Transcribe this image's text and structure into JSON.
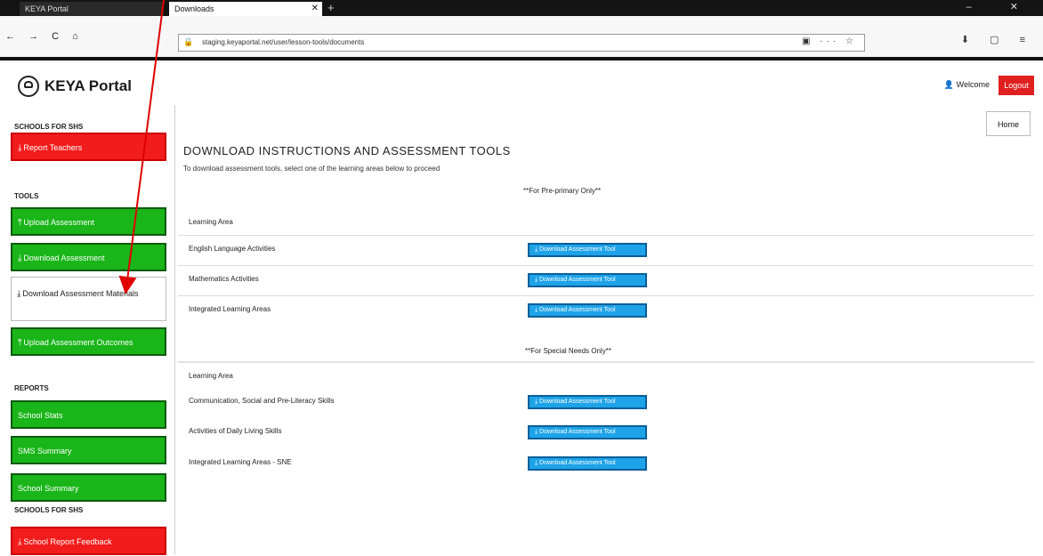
{
  "browser": {
    "tabs": [
      {
        "label": "KEYA Portal"
      },
      {
        "label": "Downloads"
      }
    ],
    "new_tab_symbol": "+",
    "url": "staging.keyaportal.net/user/lesson-tools/documents",
    "nav_symbols": "← → C ⌂",
    "window_controls": "– ✕",
    "url_tools": "▣ ··· ☆",
    "right_tools": "⬇ ▢ ≡"
  },
  "header": {
    "brand": "KEYA Portal",
    "user": "Welcome",
    "logout": "Logout"
  },
  "sidebar": {
    "sections": [
      {
        "title": "SCHOOLS FOR SHS"
      },
      {
        "title": "TOOLS"
      },
      {
        "title": "REPORTS"
      },
      {
        "title": "SCHOOLS FOR SHS"
      }
    ],
    "items": [
      {
        "label": "Report Teachers",
        "icon": "download-icon"
      },
      {
        "label": "Upload Assessment",
        "icon": "upload-icon"
      },
      {
        "label": "Download Assessment",
        "icon": "download-icon"
      },
      {
        "label": "Download Assessment Materials",
        "icon": "download-icon"
      },
      {
        "label": "Upload Assessment Outcomes",
        "icon": "upload-icon"
      },
      {
        "label": "School Stats"
      },
      {
        "label": "SMS Summary"
      },
      {
        "label": "School Summary"
      },
      {
        "label": "School Report Feedback",
        "icon": "download-icon"
      }
    ]
  },
  "main": {
    "home": "Home",
    "title": "DOWNLOAD INSTRUCTIONS AND ASSESSMENT TOOLS",
    "instruction": "To download assessment tools, select one of the learning areas below to proceed",
    "pp_note": "**For Pre-primary Only**",
    "learning_area_header": "Learning Area",
    "pp_rows": [
      {
        "label": "English Language Activities",
        "button": "Download Assessment Tool"
      },
      {
        "label": "Mathematics Activities",
        "button": "Download Assessment Tool"
      },
      {
        "label": "Integrated Learning Areas",
        "button": "Download Assessment Tool"
      }
    ],
    "sn_note": "**For Special Needs Only**",
    "learning_area_header_2": "Learning Area",
    "sn_rows": [
      {
        "label": "Communication, Social and Pre-Literacy Skills",
        "button": "Download Assessment Tool"
      },
      {
        "label": "Activities of Daily Living Skills",
        "button": "Download Assessment Tool"
      },
      {
        "label": "Integrated Learning Areas - SNE",
        "button": "Download Assessment Tool"
      }
    ]
  },
  "colors": {
    "red_button": "#f21c1c",
    "green_button": "#19b519",
    "download_button": "#1ea3e8",
    "annotation_arrow": "#e00000"
  }
}
